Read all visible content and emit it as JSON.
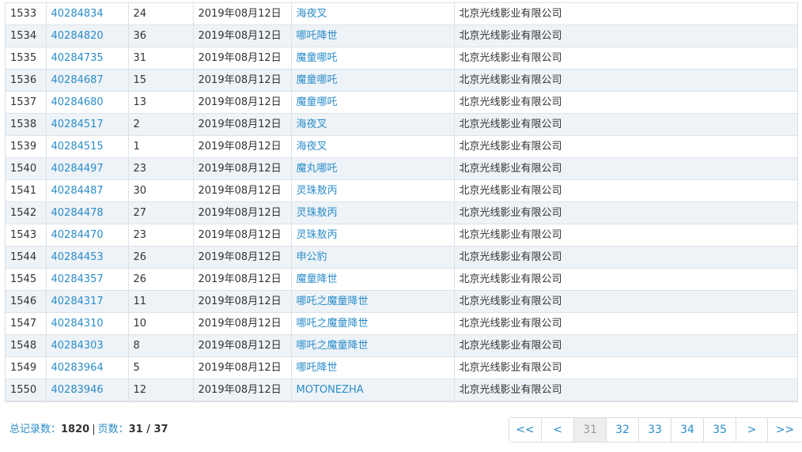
{
  "rows": [
    {
      "no": "1533",
      "id": "40284834",
      "count": "24",
      "date": "2019年08月12日",
      "title": "海夜叉",
      "company": "北京光线影业有限公司"
    },
    {
      "no": "1534",
      "id": "40284820",
      "count": "36",
      "date": "2019年08月12日",
      "title": "哪吒降世",
      "company": "北京光线影业有限公司"
    },
    {
      "no": "1535",
      "id": "40284735",
      "count": "31",
      "date": "2019年08月12日",
      "title": "魔童哪吒",
      "company": "北京光线影业有限公司"
    },
    {
      "no": "1536",
      "id": "40284687",
      "count": "15",
      "date": "2019年08月12日",
      "title": "魔童哪吒",
      "company": "北京光线影业有限公司"
    },
    {
      "no": "1537",
      "id": "40284680",
      "count": "13",
      "date": "2019年08月12日",
      "title": "魔童哪吒",
      "company": "北京光线影业有限公司"
    },
    {
      "no": "1538",
      "id": "40284517",
      "count": "2",
      "date": "2019年08月12日",
      "title": "海夜叉",
      "company": "北京光线影业有限公司"
    },
    {
      "no": "1539",
      "id": "40284515",
      "count": "1",
      "date": "2019年08月12日",
      "title": "海夜叉",
      "company": "北京光线影业有限公司"
    },
    {
      "no": "1540",
      "id": "40284497",
      "count": "23",
      "date": "2019年08月12日",
      "title": "魔丸哪吒",
      "company": "北京光线影业有限公司"
    },
    {
      "no": "1541",
      "id": "40284487",
      "count": "30",
      "date": "2019年08月12日",
      "title": "灵珠敖丙",
      "company": "北京光线影业有限公司"
    },
    {
      "no": "1542",
      "id": "40284478",
      "count": "27",
      "date": "2019年08月12日",
      "title": "灵珠敖丙",
      "company": "北京光线影业有限公司"
    },
    {
      "no": "1543",
      "id": "40284470",
      "count": "23",
      "date": "2019年08月12日",
      "title": "灵珠敖丙",
      "company": "北京光线影业有限公司"
    },
    {
      "no": "1544",
      "id": "40284453",
      "count": "26",
      "date": "2019年08月12日",
      "title": "申公豹",
      "company": "北京光线影业有限公司"
    },
    {
      "no": "1545",
      "id": "40284357",
      "count": "26",
      "date": "2019年08月12日",
      "title": "魔童降世",
      "company": "北京光线影业有限公司"
    },
    {
      "no": "1546",
      "id": "40284317",
      "count": "11",
      "date": "2019年08月12日",
      "title": "哪吒之魔童降世",
      "company": "北京光线影业有限公司"
    },
    {
      "no": "1547",
      "id": "40284310",
      "count": "10",
      "date": "2019年08月12日",
      "title": "哪吒之魔童降世",
      "company": "北京光线影业有限公司"
    },
    {
      "no": "1548",
      "id": "40284303",
      "count": "8",
      "date": "2019年08月12日",
      "title": "哪吒之魔童降世",
      "company": "北京光线影业有限公司"
    },
    {
      "no": "1549",
      "id": "40283964",
      "count": "5",
      "date": "2019年08月12日",
      "title": "哪吒降世",
      "company": "北京光线影业有限公司"
    },
    {
      "no": "1550",
      "id": "40283946",
      "count": "12",
      "date": "2019年08月12日",
      "title": "MOTONEZHA",
      "company": "北京光线影业有限公司"
    }
  ],
  "summary": {
    "total_label": "总记录数：",
    "total_value": "1820",
    "separator": "|",
    "pages_label": "页数：",
    "pages_value": "31 / 37"
  },
  "pagination": {
    "first": "<<",
    "prev": "<",
    "pages": [
      "31",
      "32",
      "33",
      "34",
      "35"
    ],
    "current": "31",
    "next": ">",
    "last": ">>"
  },
  "colors": {
    "link": "#2a8cc9",
    "row_alt": "#eef3f8",
    "border": "#dde2e7"
  }
}
